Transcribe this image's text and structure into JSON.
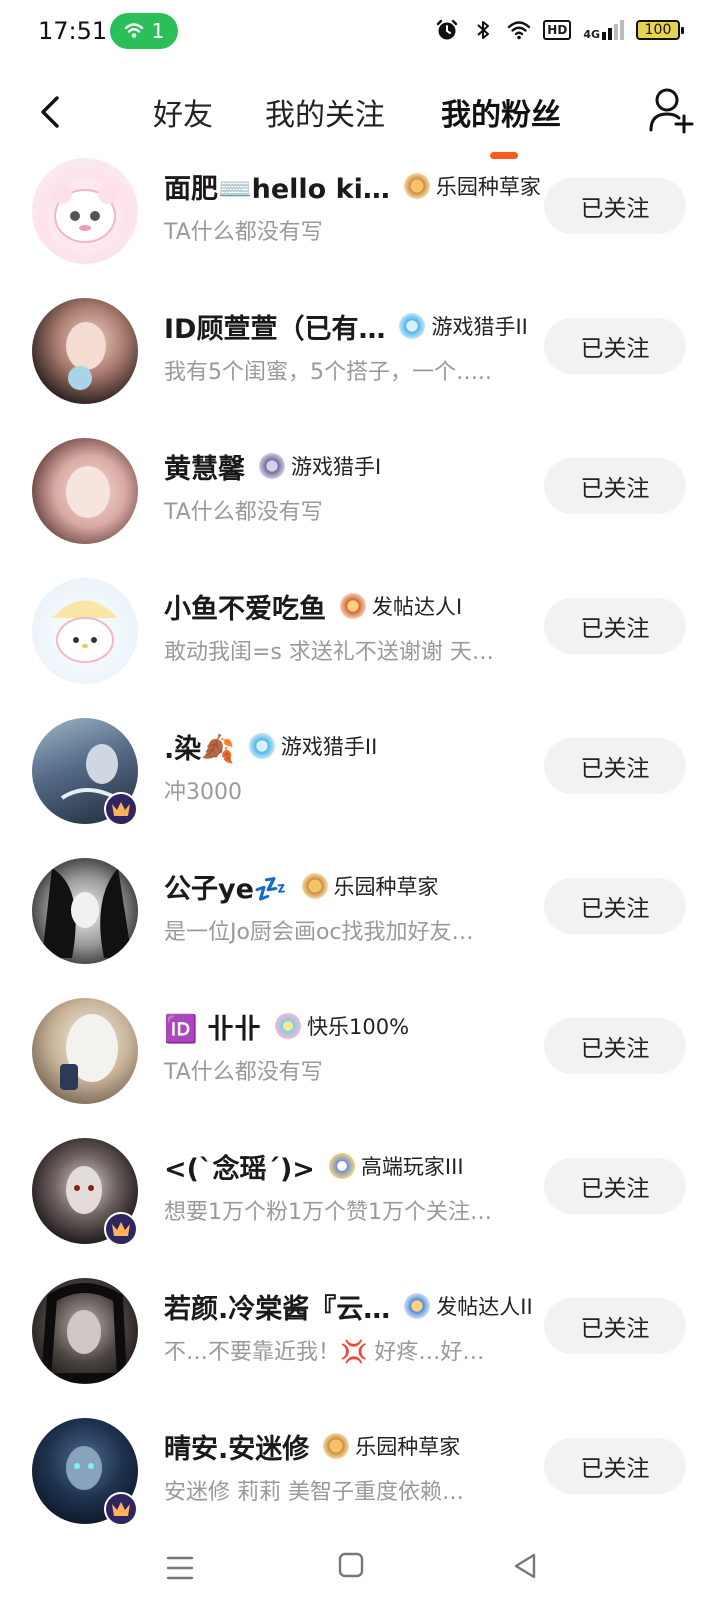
{
  "status_bar": {
    "time": "17:51",
    "hotspot_count": "1",
    "hd_label": "HD",
    "network_label": "4G",
    "battery": "100"
  },
  "header": {
    "tabs": [
      {
        "label": "好友",
        "active": false
      },
      {
        "label": "我的关注",
        "active": false
      },
      {
        "label": "我的粉丝",
        "active": true
      }
    ],
    "accent_color": "#ff5a1f"
  },
  "followers": [
    {
      "name": "面肥⌨️hello ki…",
      "title": "乐园种草家",
      "bio": "TA什么都没有写",
      "button": "已关注",
      "vip": false
    },
    {
      "name": "ID顾萱萱（已有…",
      "title": "游戏猎手II",
      "bio": "我有5个闺蜜，5个搭子，一个…..",
      "button": "已关注",
      "vip": false
    },
    {
      "name": "黄慧馨",
      "title": "游戏猎手I",
      "bio": "TA什么都没有写",
      "button": "已关注",
      "vip": false
    },
    {
      "name": "小鱼不爱吃鱼",
      "title": "发帖达人I",
      "bio": "敢动我闺=s 求送礼不送谢谢 天…",
      "button": "已关注",
      "vip": false
    },
    {
      "name": ".染🍂",
      "title": "游戏猎手II",
      "bio": "冲3000",
      "button": "已关注",
      "vip": true
    },
    {
      "name": "公子ye💤",
      "title": "乐园种草家",
      "bio": "是一位Jo厨会画oc找我加好友…",
      "button": "已关注",
      "vip": false
    },
    {
      "name": "🆔 卝卝",
      "title": "快乐100%",
      "bio": "TA什么都没有写",
      "button": "已关注",
      "vip": false
    },
    {
      "name": "<(`念瑶´)>",
      "title": "高端玩家III",
      "bio": "想要1万个粉1万个赞1万个关注…",
      "button": "已关注",
      "vip": true
    },
    {
      "name": "若颜.冷棠酱『云…",
      "title": "发帖达人II",
      "bio": "不…不要靠近我！💢 好疼…好…",
      "button": "已关注",
      "vip": false
    },
    {
      "name": "晴安.安迷修",
      "title": "乐园种草家",
      "bio": "安迷修 莉莉 美智子重度依赖…",
      "button": "已关注",
      "vip": true
    }
  ]
}
